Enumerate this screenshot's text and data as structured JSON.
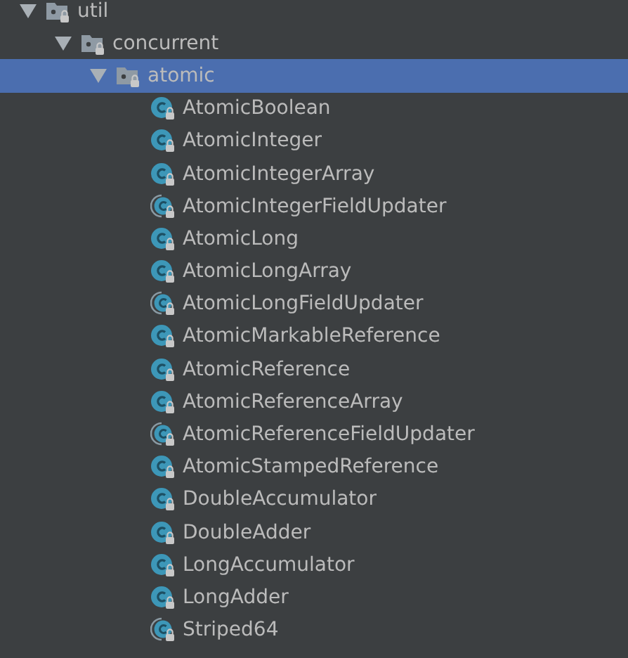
{
  "tree": [
    {
      "kind": "package",
      "label": "util",
      "expanded": true,
      "selected": false,
      "children": [
        {
          "kind": "package",
          "label": "concurrent",
          "expanded": true,
          "selected": false,
          "children": [
            {
              "kind": "package",
              "label": "atomic",
              "expanded": true,
              "selected": true,
              "children": [
                {
                  "kind": "class",
                  "label": "AtomicBoolean",
                  "selected": false
                },
                {
                  "kind": "class",
                  "label": "AtomicInteger",
                  "selected": false
                },
                {
                  "kind": "class",
                  "label": "AtomicIntegerArray",
                  "selected": false
                },
                {
                  "kind": "abstract_class",
                  "label": "AtomicIntegerFieldUpdater",
                  "selected": false
                },
                {
                  "kind": "class",
                  "label": "AtomicLong",
                  "selected": false
                },
                {
                  "kind": "class",
                  "label": "AtomicLongArray",
                  "selected": false
                },
                {
                  "kind": "abstract_class",
                  "label": "AtomicLongFieldUpdater",
                  "selected": false
                },
                {
                  "kind": "class",
                  "label": "AtomicMarkableReference",
                  "selected": false
                },
                {
                  "kind": "class",
                  "label": "AtomicReference",
                  "selected": false
                },
                {
                  "kind": "class",
                  "label": "AtomicReferenceArray",
                  "selected": false
                },
                {
                  "kind": "abstract_class",
                  "label": "AtomicReferenceFieldUpdater",
                  "selected": false
                },
                {
                  "kind": "class",
                  "label": "AtomicStampedReference",
                  "selected": false
                },
                {
                  "kind": "class",
                  "label": "DoubleAccumulator",
                  "selected": false
                },
                {
                  "kind": "class",
                  "label": "DoubleAdder",
                  "selected": false
                },
                {
                  "kind": "class",
                  "label": "LongAccumulator",
                  "selected": false
                },
                {
                  "kind": "class",
                  "label": "LongAdder",
                  "selected": false
                },
                {
                  "kind": "abstract_class",
                  "label": "Striped64",
                  "selected": false
                }
              ]
            }
          ]
        }
      ]
    }
  ]
}
